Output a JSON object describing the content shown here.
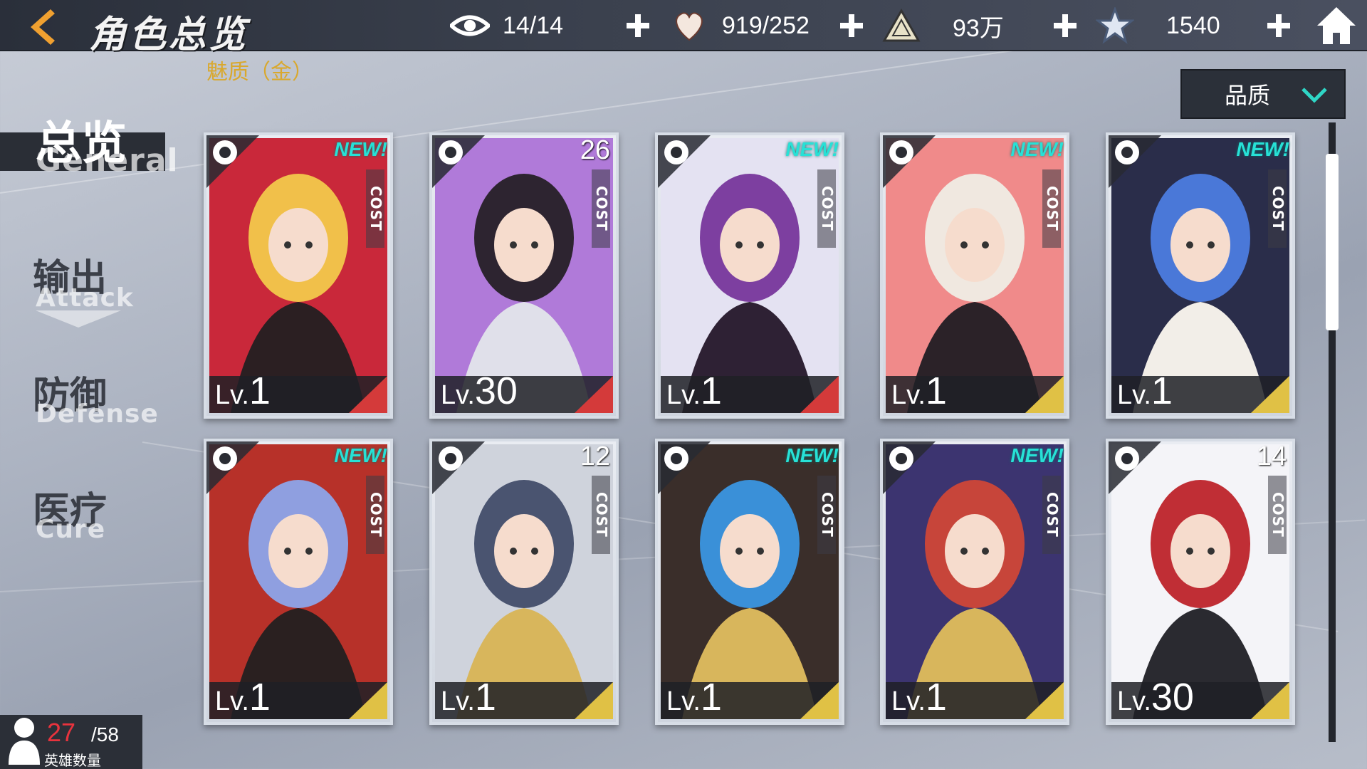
{
  "header": {
    "title": "角色总览",
    "sort_tag": "魅质（金）",
    "resources": [
      {
        "icon": "eye-icon",
        "value": "14/14"
      },
      {
        "icon": "heart-icon",
        "value": "919/252"
      },
      {
        "icon": "triangle-crystal-icon",
        "value": "93万"
      },
      {
        "icon": "star-icon",
        "value": "1540"
      }
    ]
  },
  "sort_dropdown": {
    "label": "品质"
  },
  "nav": [
    {
      "cn": "总览",
      "en": "General",
      "active": true
    },
    {
      "cn": "输出",
      "en": "Attack"
    },
    {
      "cn": "防御",
      "en": "Defense"
    },
    {
      "cn": "医疗",
      "en": "Cure"
    }
  ],
  "cards": [
    {
      "class_icon": "fire-emblem-icon",
      "badge": "NEW!",
      "cost_label": "COST",
      "cost": "",
      "lv_prefix": "Lv.",
      "level": "1",
      "rarity_color": "#d43a3a"
    },
    {
      "class_icon": "pistol-icon",
      "badge": "",
      "cost_label": "COST",
      "cost": "26",
      "lv_prefix": "Lv.",
      "level": "30",
      "rarity_color": "#d43a3a"
    },
    {
      "class_icon": "crown-cross-icon",
      "badge": "NEW!",
      "cost_label": "COST",
      "cost": "",
      "lv_prefix": "Lv.",
      "level": "1",
      "rarity_color": "#d43a3a"
    },
    {
      "class_icon": "crown-cross-icon",
      "badge": "NEW!",
      "cost_label": "COST",
      "cost": "",
      "lv_prefix": "Lv.",
      "level": "1",
      "rarity_color": "#e0c145"
    },
    {
      "class_icon": "fox-mask-icon",
      "badge": "NEW!",
      "cost_label": "COST",
      "cost": "",
      "lv_prefix": "Lv.",
      "level": "1",
      "rarity_color": "#e0c145"
    },
    {
      "class_icon": "shuriken-icon",
      "badge": "NEW!",
      "cost_label": "COST",
      "cost": "",
      "lv_prefix": "Lv.",
      "level": "1",
      "rarity_color": "#e0c145"
    },
    {
      "class_icon": "sword-icon",
      "badge": "",
      "cost_label": "COST",
      "cost": "12",
      "lv_prefix": "Lv.",
      "level": "1",
      "rarity_color": "#e0c145"
    },
    {
      "class_icon": "winged-heart-icon",
      "badge": "NEW!",
      "cost_label": "COST",
      "cost": "",
      "lv_prefix": "Lv.",
      "level": "1",
      "rarity_color": "#e0c145"
    },
    {
      "class_icon": "pistol-icon",
      "badge": "NEW!",
      "cost_label": "COST",
      "cost": "",
      "lv_prefix": "Lv.",
      "level": "1",
      "rarity_color": "#e0c145"
    },
    {
      "class_icon": "bow-icon",
      "badge": "",
      "cost_label": "COST",
      "cost": "14",
      "lv_prefix": "Lv.",
      "level": "30",
      "rarity_color": "#e0c145"
    }
  ],
  "hero_count": {
    "current": "27",
    "max": "/58",
    "label": "英雄数量"
  },
  "colors": {
    "accent_orange": "#f0a030",
    "new_badge": "#27e1d6",
    "hero_count_current": "#e8333d"
  }
}
